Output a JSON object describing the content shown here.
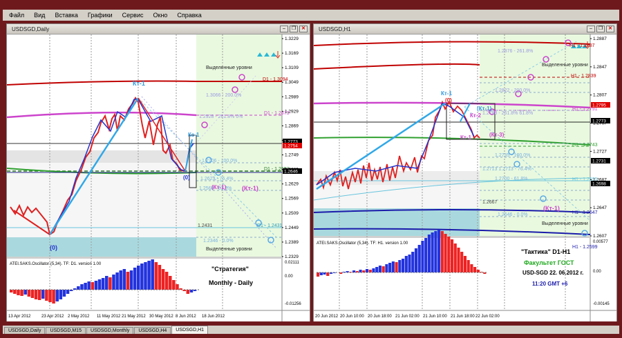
{
  "menu": [
    "Файл",
    "Вид",
    "Вставка",
    "Графики",
    "Сервис",
    "Окно",
    "Справка"
  ],
  "tabs": [
    {
      "label": "USDSGD,Daily",
      "active": false
    },
    {
      "label": "USDSGD,M15",
      "active": false
    },
    {
      "label": "USDSGD,Monthly",
      "active": false
    },
    {
      "label": "USDSGD,H4",
      "active": false
    },
    {
      "label": "USDSGD,H1",
      "active": true
    }
  ],
  "left": {
    "title": "USDSGD,Daily",
    "indicator_title": "ATEI.SAKS.Oscillator (5,34). TF: D1. version 1.00",
    "price_axis": [
      "1.3229",
      "1.3169",
      "1.3109",
      "1.3049",
      "1.2989",
      "1.2929",
      "1.2869",
      "1.2809",
      "1.2749",
      "1.2689",
      "1.2629",
      "1.2569",
      "1.2509",
      "1.2449",
      "1.2389",
      "1.2329"
    ],
    "price_tags": [
      {
        "text": "1.2773",
        "color": "#000000"
      },
      {
        "text": "1.2754",
        "color": "#e00000"
      },
      {
        "text": "1.2646",
        "color": "#000000"
      }
    ],
    "time_axis": [
      "13 Apr 2012",
      "23 Apr 2012",
      "2 May 2012",
      "11 May 2012",
      "21 May 2012",
      "30 May 2012",
      "8 Jun 2012",
      "18 Jun 2012"
    ],
    "ind_axis": [
      "0.02111",
      "0.00",
      "-0.01256"
    ],
    "labels": {
      "highlighted_top": "Выделенные уровни",
      "highlighted_bottom": "Выделенные уровни",
      "d1_1": "D1 - 1.3094",
      "d1_2": "D1 - 1.2873",
      "d1_3": "D1 - 1.2652",
      "d1_4": "D1 - 1.2431",
      "fib_200": "1.3066 - 200.0%",
      "fib_2618": "1.2928 - 261.8% 0%",
      "fib_100": "1.2706 - 100.0%",
      "fib_764": "1.2623 - 76.4%",
      "fib_618": "1.2568 - 61.8%",
      "fib_0": "1.2346 - 0.0%",
      "lvl_2431": "1.2431",
      "kt1_top": "Кт-1",
      "kc1": "Кс-1",
      "kt1_mid": "(Кт-1)",
      "kt1_right": "(Кт-1)",
      "zero_bottom": "(0)",
      "zero_mid": "(0)",
      "strategy_1": "\"Стратегия\"",
      "strategy_2": "Monthly - Daily"
    }
  },
  "right": {
    "title": "USDSGD,H1",
    "indicator_title": "ATEI.SAKS.Oscillator (5,34). TF: H1. version 1.00",
    "price_axis": [
      "1.2887",
      "1.2847",
      "1.2807",
      "1.2767",
      "1.2727",
      "1.2687",
      "1.2647",
      "1.2607"
    ],
    "price_tags": [
      {
        "text": "1.2795",
        "color": "#e00000"
      },
      {
        "text": "1.2773",
        "color": "#000000"
      },
      {
        "text": "1.2731",
        "color": "#000000"
      },
      {
        "text": "1.2698",
        "color": "#000000"
      }
    ],
    "time_axis": [
      "20 Jun 2012",
      "20 Jun 10:00",
      "20 Jun 18:00",
      "21 Jun 02:00",
      "21 Jun 10:00",
      "21 Jun 18:00",
      "22 Jun 02:00"
    ],
    "ind_axis": [
      "0.00577",
      "0.00",
      "-0.00145"
    ],
    "labels": {
      "h1_2887": "H1 - 1.2887",
      "h1_2839": "H1 - 1.2839",
      "h1_2791": "H1 - 1.2791",
      "h1_2743": "H1 - 1.2743",
      "h1_2695": "H1 - 1.2695",
      "h1_2647": "H1 - 1.2647",
      "h1_2599": "H1 - 1.2599",
      "fib_2618": "1.2876 - 261.8%",
      "fib_200": "1.2822 - 200.0%",
      "fib_2618b": "1.2788 - 261.8% 61.8%",
      "fib_100": "1.2735 - 100.0%",
      "fib_764": "1.2713 1.2713 - 76.4%",
      "fib_618": "1.2700 - 61.8%",
      "lvl_2667": "1.2667",
      "fib_0": "1.2646 - 0.0%",
      "highlighted_top": "Выделенные уровни",
      "highlighted_bottom": "Выделенные уровни",
      "kt1_left": "Кт-1",
      "kt1_box": "(Кт-1)",
      "kt2": "Кт-2",
      "kt1_low": "Кт-1",
      "kt3": "(Кт-3)",
      "kt1_right": "(Кт-1)",
      "zero": "(0)",
      "tactic_1": "\"Тактика\"   D1-H1",
      "tactic_2": "Факультет ГОСТ",
      "tactic_3": "USD-SGD 22. 06.2012 г.",
      "tactic_4": "11:20  GMT +6"
    }
  }
}
